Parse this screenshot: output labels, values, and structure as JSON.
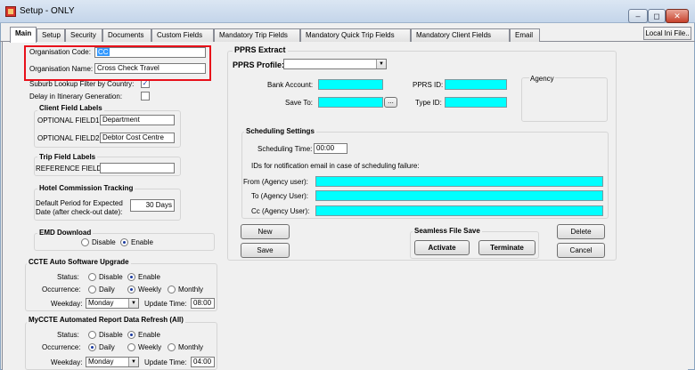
{
  "window": {
    "title": "Setup - ONLY",
    "buttons": {
      "minimize": "–",
      "restore": "◻",
      "close": "✕"
    }
  },
  "tabs": [
    "Main",
    "Setup",
    "Security",
    "Documents",
    "Custom Fields",
    "Mandatory Trip Fields",
    "Mandatory Quick Trip Fields",
    "Mandatory Client Fields",
    "Email"
  ],
  "local_ini_button": "Local Ini File..",
  "organisation": {
    "code_label": "Organisation Code:",
    "code_value": "CC",
    "name_label": "Organisation Name:",
    "name_value": "Cross Check Travel"
  },
  "suburb_lookup": {
    "label": "Suburb Lookup Filter by Country:",
    "checked": "✓"
  },
  "delay_itinerary": {
    "label": "Delay in Itinerary Generation:"
  },
  "client_field_labels": {
    "title": "Client Field Labels",
    "field1_label": "OPTIONAL FIELD1:",
    "field1_value": "Department",
    "field2_label": "OPTIONAL FIELD2:",
    "field2_value": "Debtor Cost Centre"
  },
  "trip_field_labels": {
    "title": "Trip Field Labels",
    "reference_label": "REFERENCE FIELD:",
    "reference_value": ""
  },
  "hotel_commission": {
    "title": "Hotel Commission Tracking",
    "period_label_line1": "Default Period for Expected",
    "period_label_line2": "Date (after check-out date):",
    "period_value": "30 Days"
  },
  "emd_download": {
    "title": "EMD Download",
    "disable": "Disable",
    "enable": "Enable"
  },
  "ccte_upgrade": {
    "title": "CCTE Auto Software Upgrade",
    "status_label": "Status:",
    "disable": "Disable",
    "enable": "Enable",
    "occurrence_label": "Occurrence:",
    "daily": "Daily",
    "weekly": "Weekly",
    "monthly": "Monthly",
    "weekday_label": "Weekday:",
    "weekday_value": "Monday",
    "update_time_label": "Update Time:",
    "update_time_value": "08:00"
  },
  "mycte_refresh": {
    "title": "MyCCTE Automated Report Data Refresh (All)",
    "status_label": "Status:",
    "disable": "Disable",
    "enable": "Enable",
    "occurrence_label": "Occurrence:",
    "daily": "Daily",
    "weekly": "Weekly",
    "monthly": "Monthly",
    "weekday_label": "Weekday:",
    "weekday_value": "Monday",
    "update_time_label": "Update Time:",
    "update_time_value": "04:00"
  },
  "pprs": {
    "title": "PPRS Extract",
    "profile_label": "PPRS Profile:",
    "profile_value": "",
    "bank_account_label": "Bank Account:",
    "save_to_label": "Save To:",
    "browse": "...",
    "pprs_id_label": "PPRS ID:",
    "type_id_label": "Type ID:",
    "agency_label": "Agency"
  },
  "scheduling": {
    "title": "Scheduling Settings",
    "time_label": "Scheduling Time:",
    "time_value": "00:00",
    "ids_note": "IDs for notification email in case of scheduling failure:",
    "from_label": "From (Agency user):",
    "to_label": "To (Agency User):",
    "cc_label": "Cc (Agency User):"
  },
  "buttons": {
    "new": "New",
    "save": "Save",
    "delete": "Delete",
    "cancel": "Cancel",
    "activate": "Activate",
    "terminate": "Terminate"
  },
  "seamless": {
    "title": "Seamless File Save"
  },
  "colors": {
    "highlight_border": "#e8101a",
    "field_cyan": "#00ffff"
  }
}
